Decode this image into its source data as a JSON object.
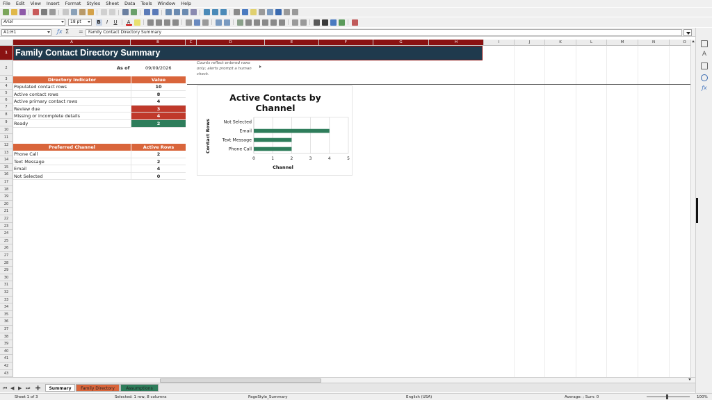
{
  "menu": [
    "File",
    "Edit",
    "View",
    "Insert",
    "Format",
    "Styles",
    "Sheet",
    "Data",
    "Tools",
    "Window",
    "Help"
  ],
  "font_name": "Arial",
  "font_size": "18 pt",
  "name_box": "A1:H1",
  "formula": "Family Contact Directory Summary",
  "columns": [
    "A",
    "B",
    "C",
    "D",
    "E",
    "F",
    "G",
    "H",
    "I",
    "J",
    "K",
    "L",
    "M",
    "N",
    "O"
  ],
  "rows": [
    "1",
    "2",
    "3",
    "4",
    "5",
    "6",
    "7",
    "8",
    "9",
    "10",
    "11",
    "12",
    "13",
    "14",
    "15",
    "16",
    "17",
    "18",
    "19",
    "20",
    "21",
    "22",
    "23",
    "24",
    "25",
    "26",
    "27",
    "28",
    "29",
    "30",
    "31",
    "32",
    "33",
    "34",
    "35",
    "36",
    "37",
    "38",
    "39",
    "40",
    "41",
    "42",
    "43"
  ],
  "sheet": {
    "title": "Family Contact Directory Summary",
    "asof_label": "As of",
    "asof_value": "09/09/2026",
    "note": "Counts reflect entered rows only; alerts prompt a human check.",
    "indicator_header": "Directory Indicator",
    "value_header": "Value",
    "indicators": [
      {
        "label": "Populated contact rows",
        "value": "10"
      },
      {
        "label": "Active contact rows",
        "value": "8"
      },
      {
        "label": "Active primary contact rows",
        "value": "4"
      },
      {
        "label": "Review due",
        "value": "3"
      },
      {
        "label": "Missing or incomplete details",
        "value": "4"
      },
      {
        "label": "Ready",
        "value": "2"
      }
    ],
    "channel_header": "Preferred Channel",
    "active_rows_header": "Active Rows",
    "channels": [
      {
        "label": "Phone Call",
        "value": "2"
      },
      {
        "label": "Text Message",
        "value": "2"
      },
      {
        "label": "Email",
        "value": "4"
      },
      {
        "label": "Not Selected",
        "value": "0"
      }
    ]
  },
  "chart_data": {
    "type": "bar",
    "orientation": "horizontal",
    "title": "Active Contacts by Channel",
    "xlabel": "Channel",
    "ylabel": "Contact Rows",
    "categories": [
      "Not Selected",
      "Email",
      "Text Message",
      "Phone Call"
    ],
    "values": [
      0,
      4,
      2,
      2
    ],
    "xlim": [
      0,
      5
    ],
    "xticks": [
      "0",
      "1",
      "2",
      "3",
      "4",
      "5"
    ],
    "grid": true,
    "bar_color": "#2e7d5b"
  },
  "tabs": [
    {
      "label": "Summary",
      "color": "#ffffff"
    },
    {
      "label": "Family Directory",
      "color": "#d9653b"
    },
    {
      "label": "Assumptions",
      "color": "#2e7d5b"
    }
  ],
  "status": {
    "sheet": "Sheet 1 of 3",
    "selection": "Selected: 1 row, 8 columns",
    "pagestyle": "PageStyle_Summary",
    "language": "English (USA)",
    "summary": "Average: ; Sum: 0",
    "zoom": "100%"
  },
  "colors": {
    "title_bg": "#1f3a4d",
    "header_bg": "#d9653b",
    "alert_red": "#c0392b",
    "ok_green": "#2e7d5b",
    "selection": "#8a1212"
  }
}
